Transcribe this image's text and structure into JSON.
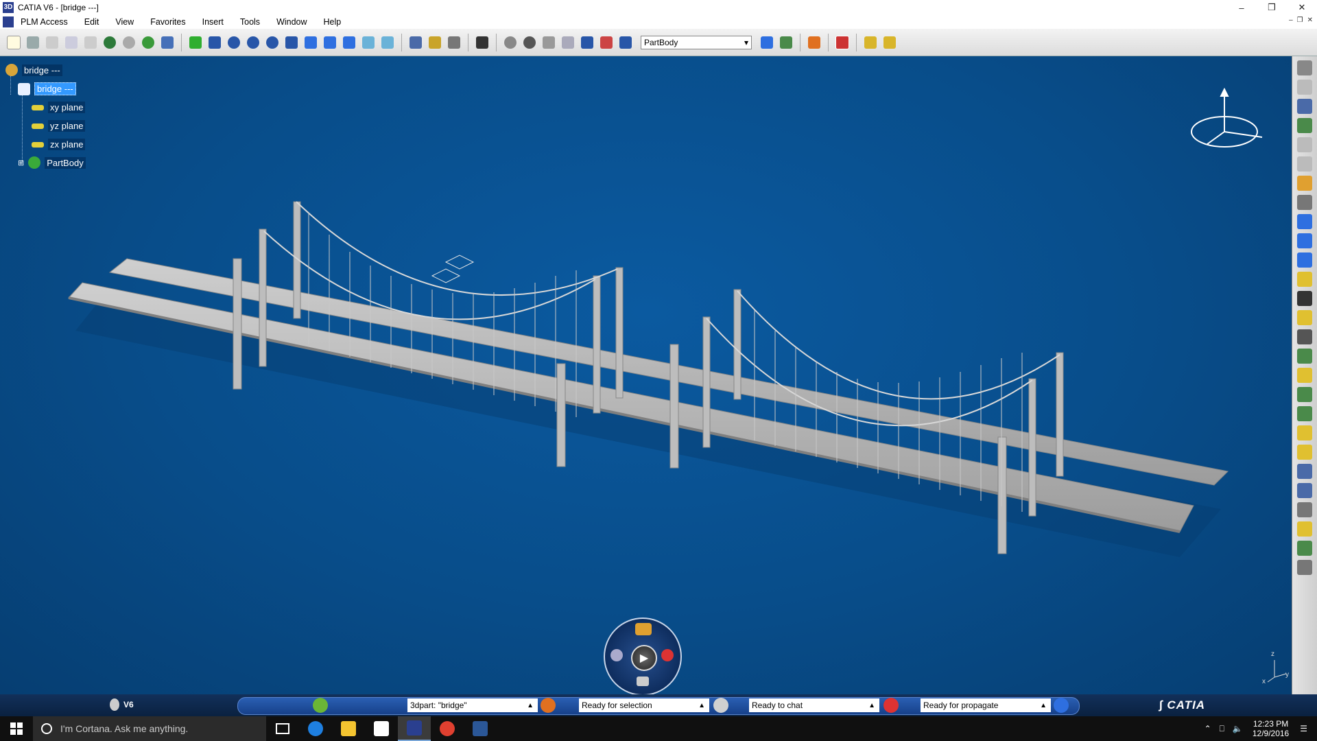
{
  "window": {
    "title": "CATIA V6 - [bridge ---]"
  },
  "menu": [
    "PLM Access",
    "Edit",
    "View",
    "Favorites",
    "Insert",
    "Tools",
    "Window",
    "Help"
  ],
  "toolbar": {
    "current_body": "PartBody"
  },
  "tree": {
    "root": "bridge ---",
    "part": "bridge ---",
    "items": [
      "xy plane",
      "yz plane",
      "zx plane",
      "PartBody"
    ]
  },
  "status": {
    "product": "V6",
    "fields": [
      "3dpart: \"bridge\"",
      "Ready for selection",
      "Ready to chat",
      "Ready for propagate"
    ],
    "brand": "CATIA"
  },
  "axes": {
    "z": "z",
    "x": "x",
    "y": "y"
  },
  "taskbar": {
    "search_placeholder": "I'm Cortana. Ask me anything.",
    "time": "12:23 PM",
    "date": "12/9/2016"
  },
  "colors": {
    "viewport": "#084d8a",
    "selection": "#3399ff",
    "bridge": "#b5b5b5"
  }
}
